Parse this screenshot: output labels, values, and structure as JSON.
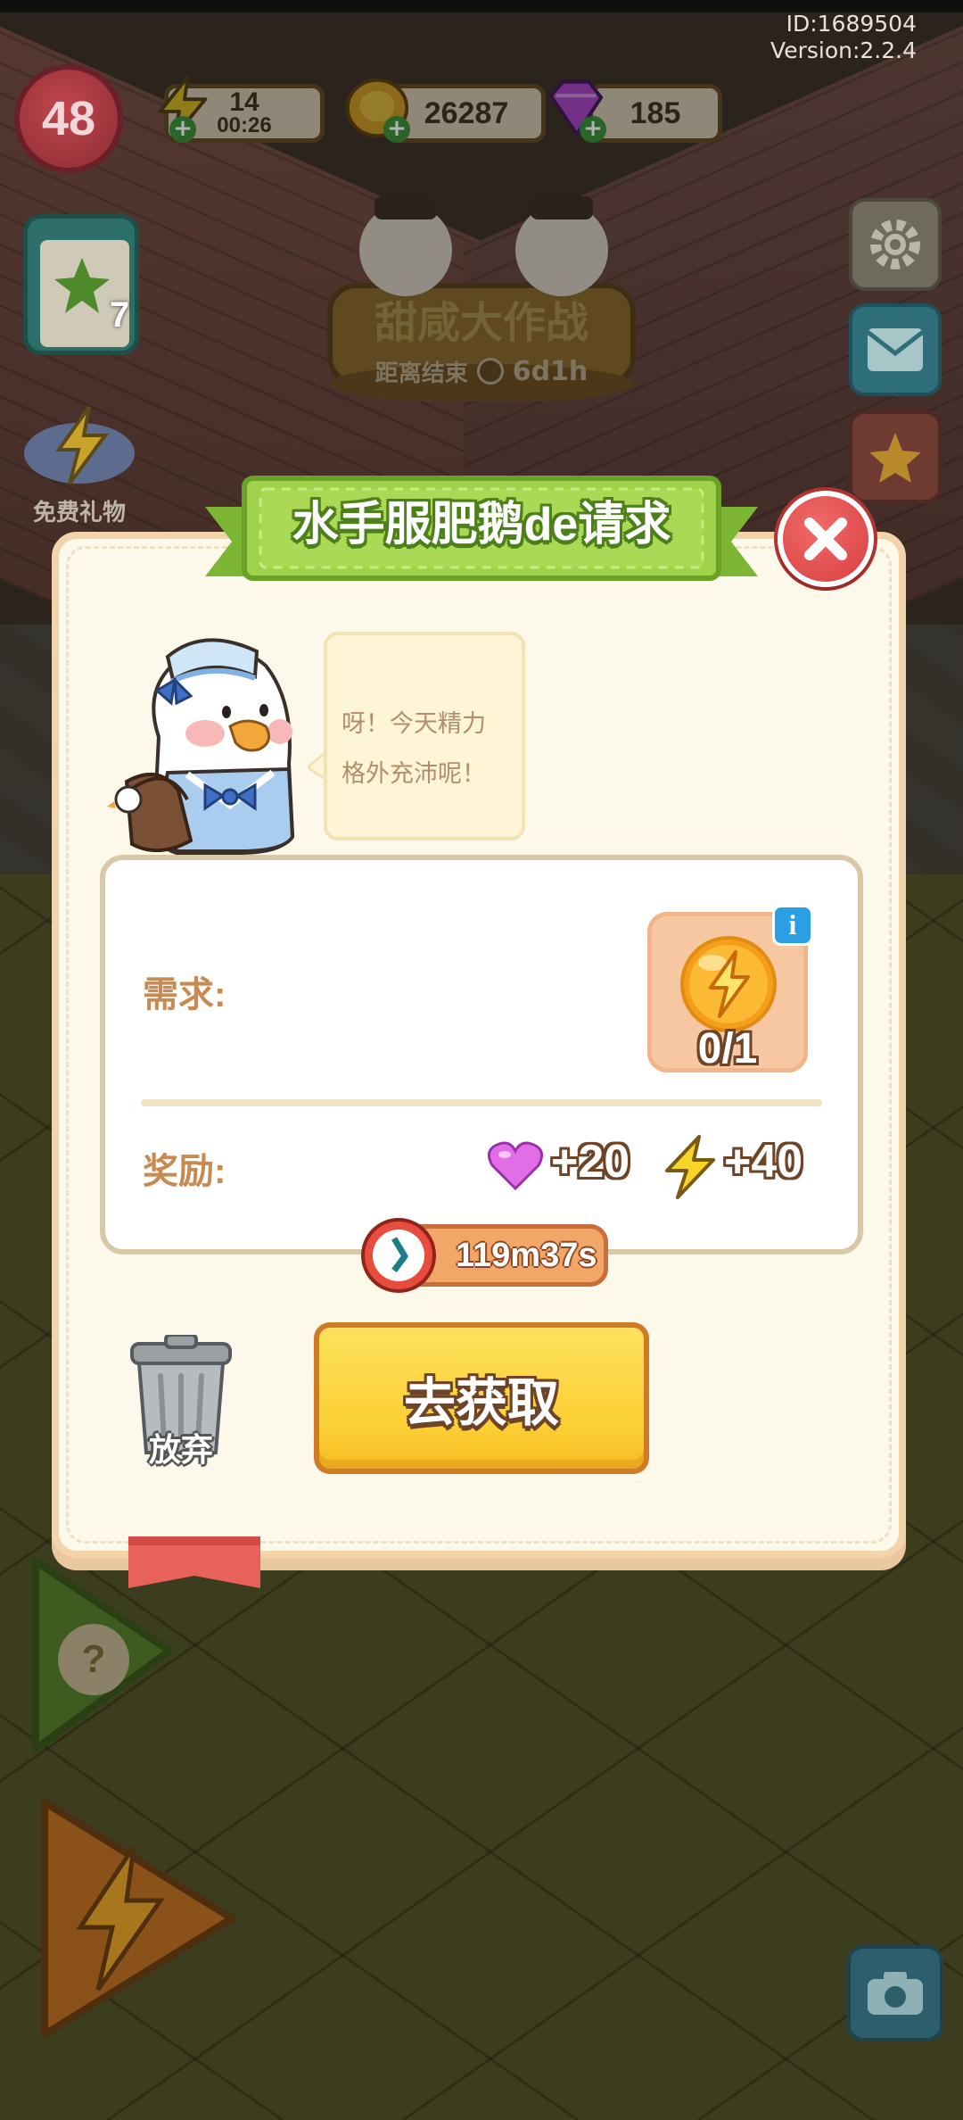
{
  "hud": {
    "player_id": "ID:1689504",
    "version": "Version:2.2.4",
    "level": "48",
    "energy": {
      "value": "14",
      "timer": "00:26"
    },
    "coins": "26287",
    "gems": "185",
    "free_gift_label": "免费礼物",
    "clipboard_count": "7",
    "event_title": "甜咸大作战",
    "event_countdown_label": "距离结束",
    "event_countdown": "6d1h"
  },
  "dialog": {
    "title": "水手服肥鹅de请求",
    "speech": "呀！今天精力格外充沛呢！",
    "requirement_label": "需求:",
    "requirement_progress": "0/1",
    "reward_label": "奖励:",
    "rewards": [
      {
        "icon": "heart-icon",
        "value": "+20"
      },
      {
        "icon": "energy-bolt-icon",
        "value": "+40"
      }
    ],
    "timer": "119m37s",
    "abandon_label": "放弃",
    "go_label": "去获取"
  },
  "colors": {
    "accent_green": "#8cc43c",
    "button_yellow": "#fbcf35",
    "close_red": "#d9403f",
    "label_brown": "#c68a52"
  }
}
